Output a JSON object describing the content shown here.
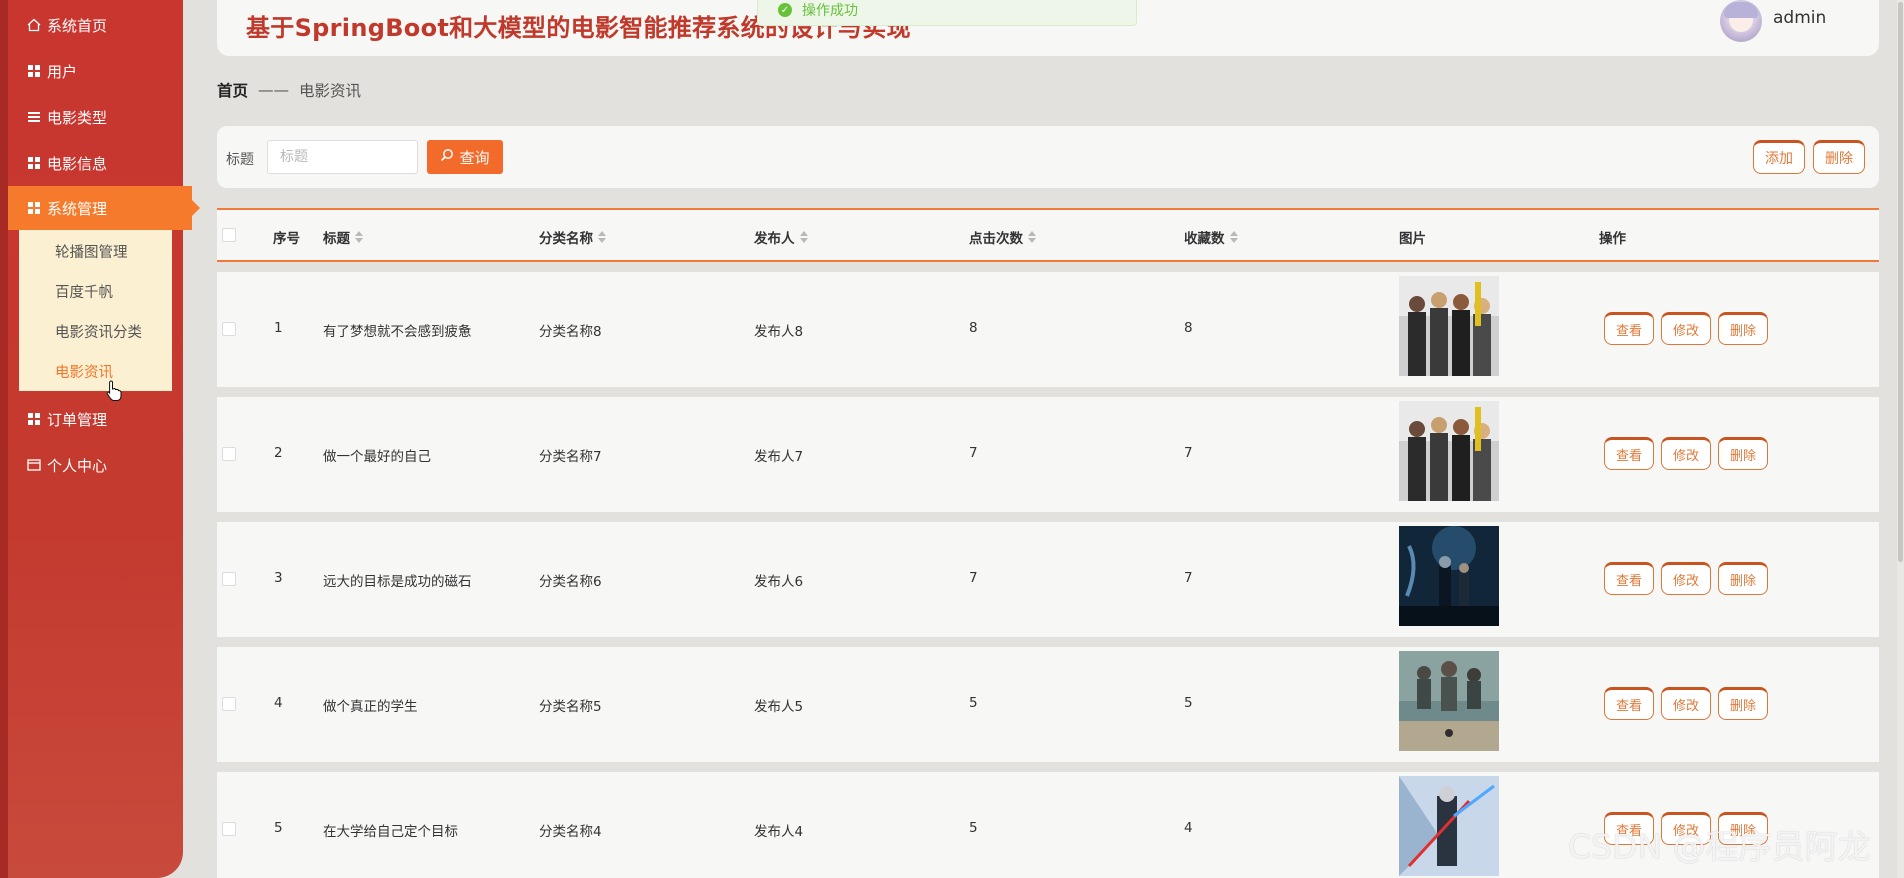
{
  "sidebar": {
    "items": [
      {
        "label": "系统首页",
        "icon": "home-icon"
      },
      {
        "label": "用户",
        "icon": "grid-icon"
      },
      {
        "label": "电影类型",
        "icon": "list-icon"
      },
      {
        "label": "电影信息",
        "icon": "grid-icon"
      },
      {
        "label": "系统管理",
        "icon": "grid-icon",
        "active": true
      },
      {
        "label": "订单管理",
        "icon": "grid-icon"
      },
      {
        "label": "个人中心",
        "icon": "card-icon"
      }
    ],
    "submenu": [
      "轮播图管理",
      "百度千帆",
      "电影资讯分类",
      "电影资讯"
    ],
    "submenu_current": "电影资讯"
  },
  "header": {
    "title": "基于SpringBoot和大模型的电影智能推荐系统的设计与实现",
    "toast": "操作成功",
    "username": "admin"
  },
  "breadcrumb": {
    "home": "首页",
    "separator": "——",
    "current": "电影资讯"
  },
  "search": {
    "label": "标题",
    "placeholder": "标题",
    "value": "",
    "query_button": "查询",
    "add_button": "添加",
    "delete_button": "删除"
  },
  "table": {
    "columns": [
      "序号",
      "标题",
      "分类名称",
      "发布人",
      "点击次数",
      "收藏数",
      "图片",
      "操作"
    ],
    "rows": [
      {
        "index": "1",
        "title": "有了梦想就不会感到疲惫",
        "category": "分类名称8",
        "publisher": "发布人8",
        "clicks": "8",
        "favorites": "8",
        "image": "poster-group-photo"
      },
      {
        "index": "2",
        "title": "做一个最好的自己",
        "category": "分类名称7",
        "publisher": "发布人7",
        "clicks": "7",
        "favorites": "7",
        "image": "poster-group-photo"
      },
      {
        "index": "3",
        "title": "远大的目标是成功的磁石",
        "category": "分类名称6",
        "publisher": "发布人6",
        "clicks": "7",
        "favorites": "7",
        "image": "poster-dark-blue"
      },
      {
        "index": "4",
        "title": "做个真正的学生",
        "category": "分类名称5",
        "publisher": "发布人5",
        "clicks": "5",
        "favorites": "5",
        "image": "poster-desert-dune"
      },
      {
        "index": "5",
        "title": "在大学给自己定个目标",
        "category": "分类名称4",
        "publisher": "发布人4",
        "clicks": "5",
        "favorites": "4",
        "image": "poster-sci-fi-blue"
      }
    ],
    "actions": {
      "view": "查看",
      "edit": "修改",
      "delete": "删除"
    }
  },
  "watermark": "CSDN @程序员阿龙",
  "colors": {
    "sidebar": "#c9362f",
    "accent": "#f26b2b",
    "submenu_bg": "#fcf0d2",
    "title": "#c0392b",
    "success": "#67c23a"
  }
}
